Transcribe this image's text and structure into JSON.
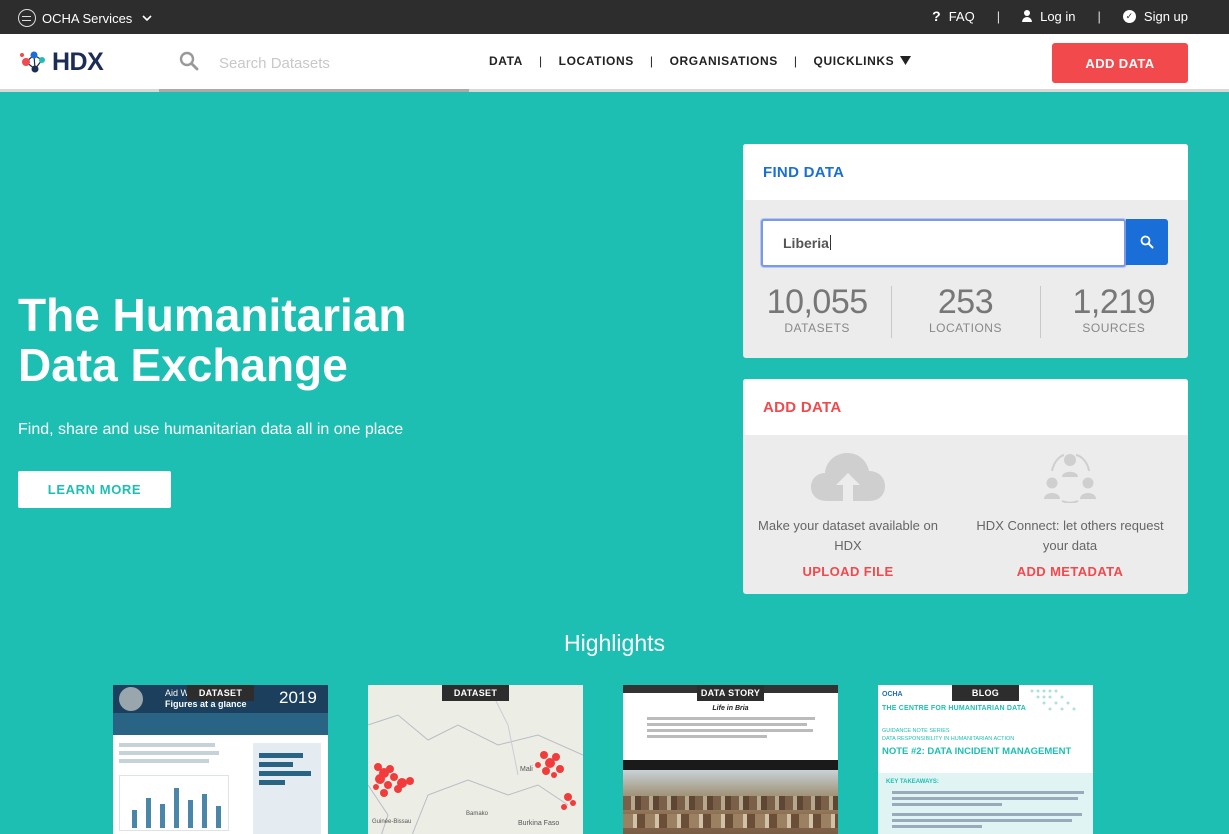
{
  "topbar": {
    "ocha_label": "OCHA Services",
    "faq_label": "FAQ",
    "login_label": "Log in",
    "signup_label": "Sign up",
    "separator": "|"
  },
  "navbar": {
    "logo_text": "HDX",
    "search_placeholder": "Search Datasets",
    "nav_items": [
      "DATA",
      "LOCATIONS",
      "ORGANISATIONS",
      "QUICKLINKS"
    ],
    "separator": "|",
    "add_data_label": "ADD DATA"
  },
  "hero": {
    "title_line1": "The Humanitarian",
    "title_line2": "Data Exchange",
    "subtitle": "Find, share and use humanitarian data all in one place",
    "learn_more_label": "LEARN MORE"
  },
  "find_data": {
    "heading": "FIND DATA",
    "search_value": "Liberia",
    "stats": [
      {
        "value": "10,055",
        "label": "DATASETS"
      },
      {
        "value": "253",
        "label": "LOCATIONS"
      },
      {
        "value": "1,219",
        "label": "SOURCES"
      }
    ]
  },
  "add_data": {
    "heading": "ADD DATA",
    "upload": {
      "desc": "Make your dataset available on HDX",
      "action": "UPLOAD FILE",
      "icon": "cloud-upload-icon"
    },
    "metadata": {
      "desc": "HDX Connect: let others request your data",
      "action": "ADD METADATA",
      "icon": "users-exchange-icon"
    }
  },
  "highlights": {
    "title": "Highlights",
    "items": [
      {
        "tag": "DATASET",
        "year_text": "2019",
        "headline": "Aid Wo",
        "sub": "Figures at a glance"
      },
      {
        "tag": "DATASET",
        "places": [
          "Mali",
          "Burkina Faso",
          "Bamako",
          "Guinée-Bissau"
        ]
      },
      {
        "tag": "DATA STORY",
        "headline": "Life in Bria"
      },
      {
        "tag": "BLOG",
        "org": "OCHA",
        "headline": "THE CENTRE FOR HUMANITARIAN DATA",
        "series": "GUIDANCE NOTE SERIES",
        "subseries": "DATA RESPONSIBILITY IN HUMANITARIAN ACTION",
        "note_title": "NOTE #2: DATA INCIDENT MANAGEMENT",
        "takeaways": "KEY TAKEAWAYS:"
      }
    ]
  },
  "colors": {
    "teal": "#1ebfb3",
    "accent_red": "#f2494d",
    "accent_blue": "#1a6ed8",
    "topbar_bg": "#2d2d2d",
    "logo_navy": "#1c2d55"
  }
}
